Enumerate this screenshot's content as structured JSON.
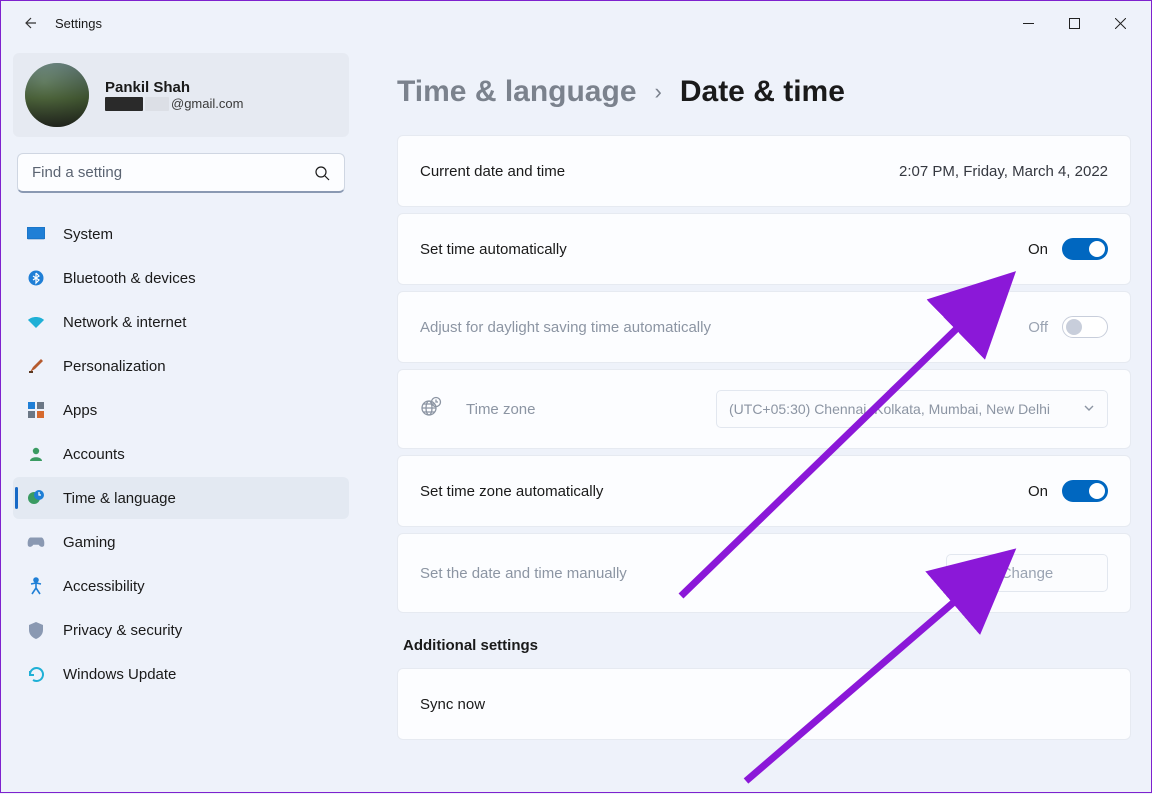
{
  "window": {
    "title": "Settings"
  },
  "user": {
    "name": "Pankil Shah",
    "email_suffix": "@gmail.com"
  },
  "search": {
    "placeholder": "Find a setting"
  },
  "nav": {
    "items": [
      {
        "label": "System"
      },
      {
        "label": "Bluetooth & devices"
      },
      {
        "label": "Network & internet"
      },
      {
        "label": "Personalization"
      },
      {
        "label": "Apps"
      },
      {
        "label": "Accounts"
      },
      {
        "label": "Time & language"
      },
      {
        "label": "Gaming"
      },
      {
        "label": "Accessibility"
      },
      {
        "label": "Privacy & security"
      },
      {
        "label": "Windows Update"
      }
    ]
  },
  "breadcrumb": {
    "parent": "Time & language",
    "current": "Date & time"
  },
  "cards": {
    "current_label": "Current date and time",
    "current_value": "2:07 PM, Friday, March 4, 2022",
    "set_time_auto_label": "Set time automatically",
    "set_time_auto_state": "On",
    "dst_label": "Adjust for daylight saving time automatically",
    "dst_state": "Off",
    "timezone_label": "Time zone",
    "timezone_value": "(UTC+05:30) Chennai, Kolkata, Mumbai, New Delhi",
    "set_tz_auto_label": "Set time zone automatically",
    "set_tz_auto_state": "On",
    "manual_label": "Set the date and time manually",
    "manual_button": "Change",
    "additional_heading": "Additional settings",
    "sync_label": "Sync now"
  }
}
